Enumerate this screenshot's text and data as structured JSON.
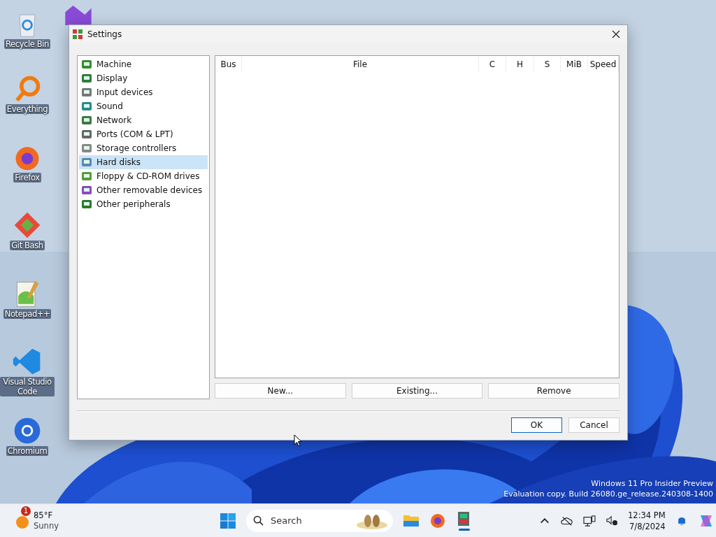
{
  "desktop_icons": [
    {
      "label": "Recycle Bin",
      "kind": "bin"
    },
    {
      "label": "Everything",
      "kind": "search"
    },
    {
      "label": "Firefox",
      "kind": "fox"
    },
    {
      "label": "Git Bash",
      "kind": "git"
    },
    {
      "label": "Notepad++",
      "kind": "notepad"
    },
    {
      "label": "Visual Studio Code",
      "kind": "code"
    },
    {
      "label": "Chromium",
      "kind": "chromium"
    }
  ],
  "window": {
    "title": "Settings",
    "sidebar": {
      "items": [
        {
          "label": "Machine",
          "selected": false
        },
        {
          "label": "Display",
          "selected": false
        },
        {
          "label": "Input devices",
          "selected": false
        },
        {
          "label": "Sound",
          "selected": false
        },
        {
          "label": "Network",
          "selected": false
        },
        {
          "label": "Ports (COM & LPT)",
          "selected": false
        },
        {
          "label": "Storage controllers",
          "selected": false
        },
        {
          "label": "Hard disks",
          "selected": true
        },
        {
          "label": "Floppy & CD-ROM drives",
          "selected": false
        },
        {
          "label": "Other removable devices",
          "selected": false
        },
        {
          "label": "Other peripherals",
          "selected": false
        }
      ]
    },
    "table": {
      "columns": [
        "Bus",
        "File",
        "C",
        "H",
        "S",
        "MiB",
        "Speed"
      ]
    },
    "actions": [
      "New...",
      "Existing...",
      "Remove"
    ],
    "buttons": [
      {
        "label": "OK",
        "default": true
      },
      {
        "label": "Cancel",
        "default": false
      }
    ]
  },
  "watermark": [
    "Windows 11 Pro Insider Preview",
    "Evaluation copy. Build 26080.ge_release.240308-1400"
  ],
  "taskbar": {
    "weather": {
      "badge": "1",
      "temperature": "85°F",
      "condition": "Sunny"
    },
    "search": {
      "placeholder": "Search"
    },
    "time": "12:34 PM",
    "date": "7/8/2024"
  }
}
